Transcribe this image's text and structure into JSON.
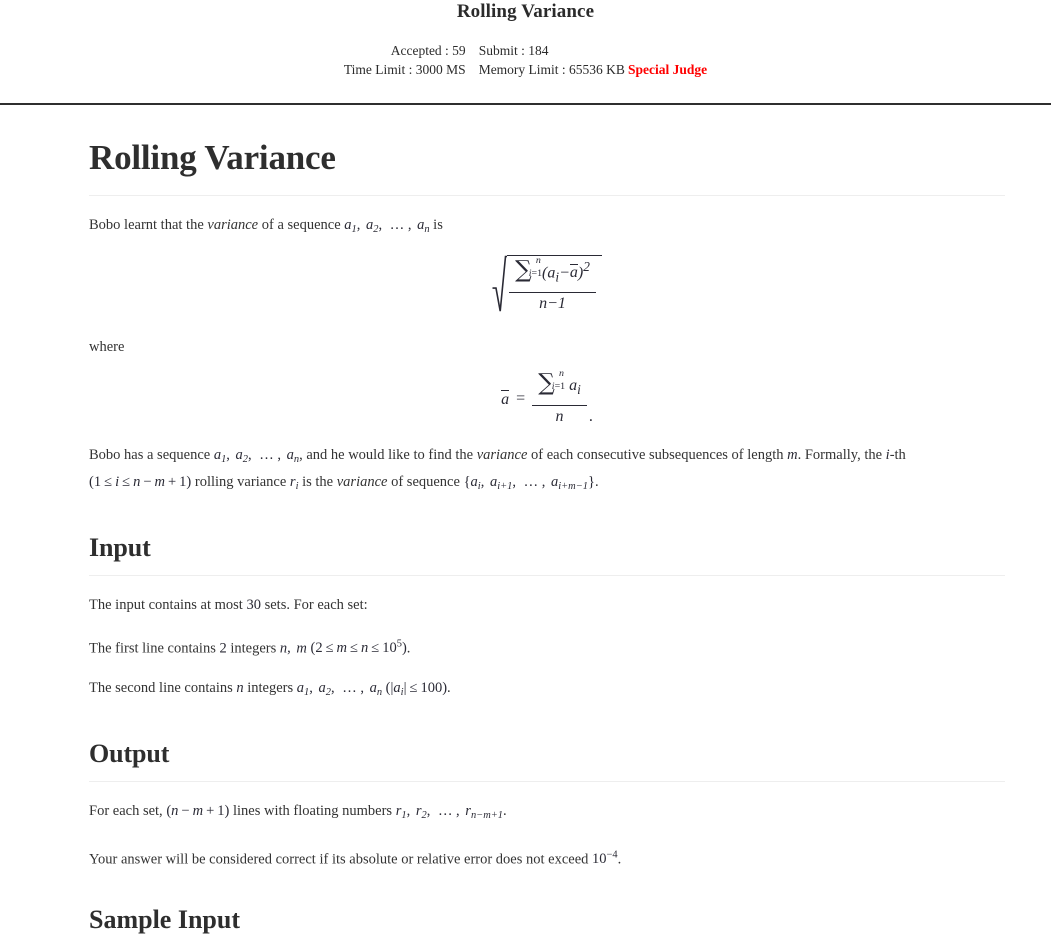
{
  "header": {
    "title": "Rolling Variance",
    "stats": [
      {
        "left": "Accepted : 59",
        "right": "Submit : 184",
        "badge": ""
      },
      {
        "left": "Time Limit : 3000 MS",
        "right": "Memory Limit : 65536 KB",
        "badge": "Special Judge"
      }
    ],
    "badge_color": "#ff0000",
    "rule_color": "#2f2f2f"
  },
  "problem": {
    "title": "Rolling Variance",
    "intro": {
      "before_italic": "Bobo learnt that the ",
      "italic": "variance",
      "after_italic": " of a sequence ",
      "math_sequence": "a_1, a_2, ..., a_n",
      "tail": " is"
    },
    "formula_variance": {
      "type": "sqrt-fraction",
      "numerator": "\\sum_{i=1}^{n} (a_i - \\bar a)^2",
      "denominator": "n - 1",
      "sum_lower": "i=1",
      "sum_upper": "n"
    },
    "where_label": "where",
    "formula_mean": {
      "type": "fraction",
      "lhs": "\\bar a =",
      "numerator": "\\sum_{i=1}^{n} a_i",
      "denominator": "n",
      "sum_lower": "i=1",
      "sum_upper": "n",
      "trailing": "."
    },
    "body1": {
      "p1": "Bobo has a sequence ",
      "seq": "a_1, a_2, ..., a_n",
      "p2": ", and he would like to find the ",
      "italic": "variance",
      "p3": " of each consecutive subsequences of length ",
      "m": "m",
      "p4": ". Formally, the ",
      "i": "i",
      "p5": "-th"
    },
    "body2": {
      "range": "(1 <= i <= n - m + 1)",
      "p1": " rolling variance ",
      "r_i": "r_i",
      "p2": " is the ",
      "italic": "variance",
      "p3": " of sequence ",
      "set": "{a_i, a_{i+1}, ..., a_{i+m-1}}",
      "p4": "."
    }
  },
  "input_section": {
    "title": "Input",
    "line1": {
      "pre": "The input contains at most ",
      "num": "30",
      "post": " sets. For each set:"
    },
    "line2": {
      "pre": "The first line contains ",
      "count": "2",
      "mid": " integers ",
      "vars": "n, m",
      "constraint": "(2 <= m <= n <= 10^5)",
      "post": "."
    },
    "line3": {
      "pre": "The second line contains ",
      "n": "n",
      "mid": " integers ",
      "seq": "a_1, a_2, ..., a_n",
      "constraint": "(|a_i| <= 100)",
      "post": "."
    }
  },
  "output_section": {
    "title": "Output",
    "line1": {
      "pre": "For each set, ",
      "expr": "(n - m + 1)",
      "mid": " lines with floating numbers ",
      "list": "r_1, r_2, ..., r_{n-m+1}",
      "post": "."
    },
    "line2": {
      "pre": "Your answer will be considered correct if its absolute or relative error does not exceed ",
      "eps": "10^-4",
      "post": "."
    }
  },
  "next_section": {
    "title": "Sample Input"
  }
}
